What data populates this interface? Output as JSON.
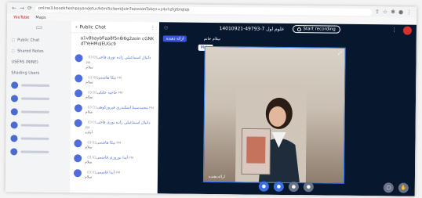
{
  "browser": {
    "url": "online3.koodsheshpayandetur/html5client/join?sessionToken=z4vhzfgtblqtqs",
    "bookmarks": [
      "YouTube",
      "Maps"
    ]
  },
  "userlist": {
    "items": [
      "Public Chat",
      "Shared Notes",
      "USERS (NINE)",
      "Shading Users"
    ]
  },
  "chat": {
    "title": "Public Chat",
    "token": "a1v8baybfiaa8f5n8i6g2zoin cGNKdTYeHMoJEUGc9",
    "messages": [
      {
        "name": "دانیال اسماعیلی زاده نوری فاجی",
        "time": "03:00 PM",
        "text": "سلام"
      },
      {
        "name": "نیکا هاشمی",
        "time": "03:00 PM",
        "text": "سلام"
      },
      {
        "name": "حاجیه خلیلی",
        "time": "03:01 PM",
        "text": "سلام"
      },
      {
        "name": "محمدسینا اسکندری فیروزکوهی",
        "time": "03:01 PM",
        "text": "سلام"
      },
      {
        "name": "دانیال اسماعیلی زاده نوری فاجی",
        "time": "03:01 PM",
        "text": "آماده"
      },
      {
        "name": "نیکا هاشمی",
        "time": "03:02 PM",
        "text": "سلام"
      },
      {
        "name": "آیدا نوروزی قاسمی",
        "time": "03:02 PM",
        "text": "سلام"
      },
      {
        "name": "آیدا قاسمی",
        "time": "03:02 PM",
        "text": "سلام"
      }
    ]
  },
  "main": {
    "meeting_title": "14010921-49793-7 علوم اول",
    "record_label": "Start recording",
    "presenter_chip": "ارائه دهنده",
    "name_chip": "سلام خانم",
    "tooltip": "Mute",
    "video_label": "ارائه‌دهنده"
  }
}
